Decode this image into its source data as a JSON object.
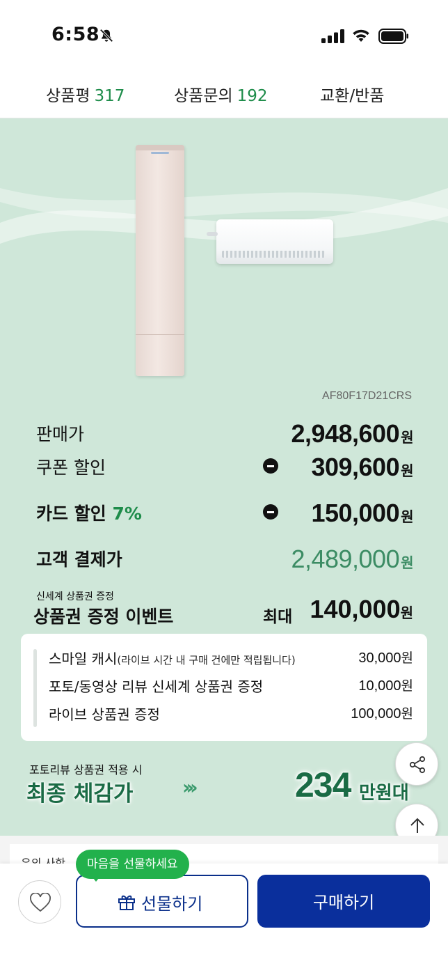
{
  "status_bar": {
    "time": "6:58"
  },
  "tabs": {
    "review_label": "상품평",
    "review_count": "317",
    "qna_label": "상품문의",
    "qna_count": "192",
    "exchange_label": "교환/반품"
  },
  "product": {
    "model_code": "AF80F17D21CRS"
  },
  "prices": {
    "sale_label": "판매가",
    "sale_value": "2,948,600",
    "coupon_label": "쿠폰 할인",
    "coupon_value": "309,600",
    "card_label": "카드 할인",
    "card_percent": "7%",
    "card_value": "150,000",
    "final_label": "고객 결제가",
    "final_value": "2,489,000",
    "currency": "원"
  },
  "event": {
    "small_label": "신세계 상품권 증정",
    "title": "상품권 증정 이벤트",
    "max_label": "최대",
    "max_value": "140,000",
    "currency": "원"
  },
  "benefits": [
    {
      "label": "스마일 캐시",
      "note": "(라이브  시간 내 구매 건에만  적립됩니다)",
      "amount": "30,000",
      "currency": "원"
    },
    {
      "label": "포토/동영상 리뷰 신세계 상품권 증정",
      "note": "",
      "amount": "10,000",
      "currency": "원"
    },
    {
      "label": "라이브 상품권 증정",
      "note": "",
      "amount": "100,000",
      "currency": "원"
    }
  ],
  "final_price": {
    "small_label": "포토리뷰 상품권 적용 시",
    "title": "최종 체감가",
    "chevrons": "›››",
    "value": "234",
    "unit": "만원대"
  },
  "notice": {
    "label": "유의 사항"
  },
  "bottom_bar": {
    "gift_tooltip": "마음을 선물하세요",
    "gift_label": "선물하기",
    "buy_label": "구매하기"
  },
  "colors": {
    "promo_background": "#cfe7d9",
    "accent_green": "#1e8c4a",
    "final_green": "#1a6b45",
    "brand_blue": "#0a2f9c",
    "tooltip_green": "#22b14c"
  },
  "icons": {
    "mute": "bell-slash-icon",
    "signal": "cellular-signal-icon",
    "wifi": "wifi-icon",
    "battery": "battery-icon",
    "share": "share-icon",
    "top": "arrow-up-icon",
    "like": "heart-icon",
    "gift": "gift-icon",
    "minus": "minus-circle-icon"
  }
}
